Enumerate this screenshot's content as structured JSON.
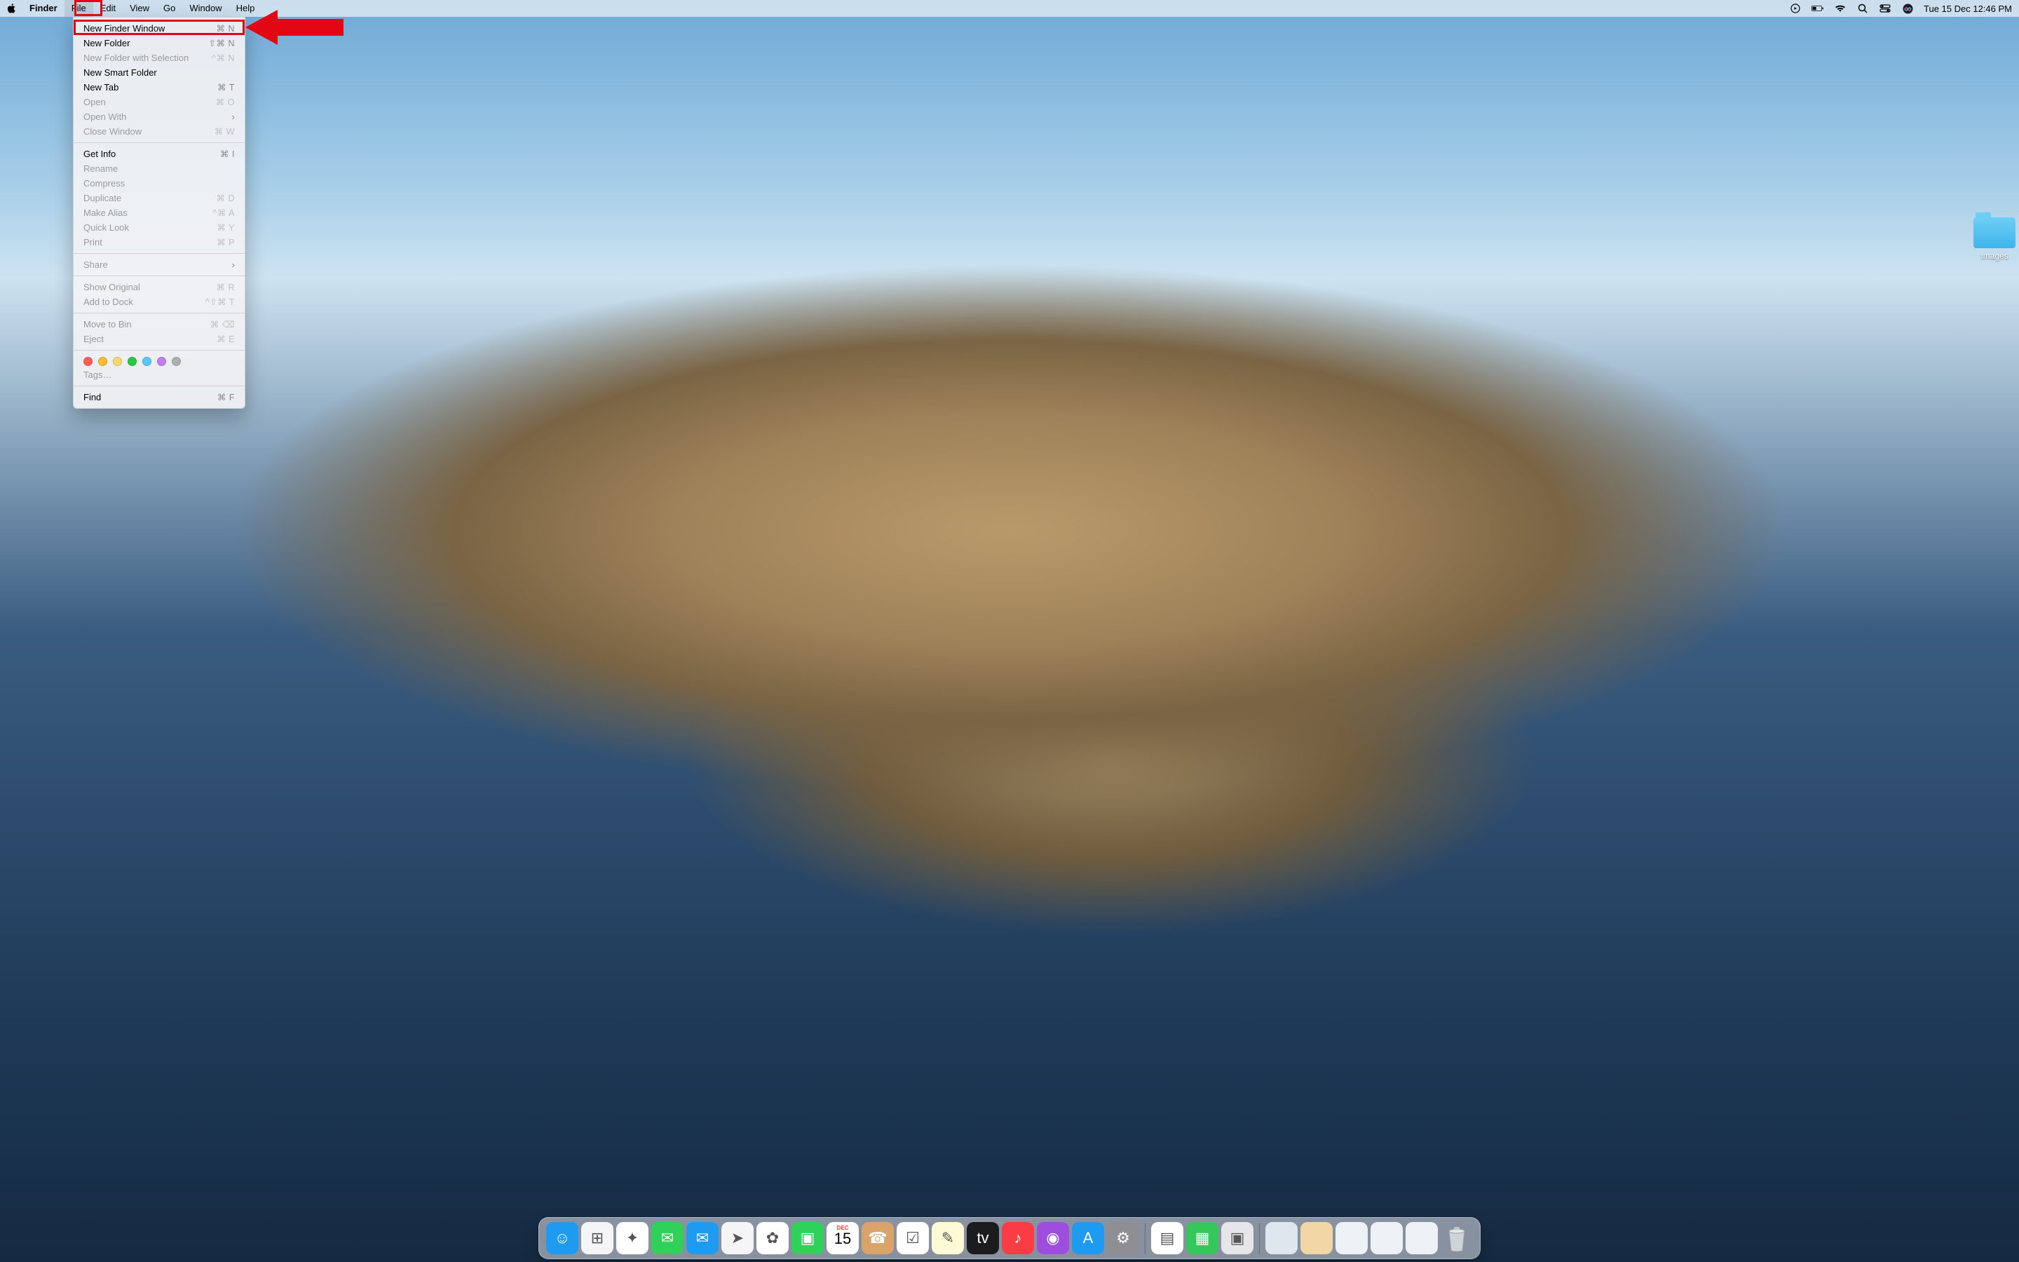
{
  "menubar": {
    "app_name": "Finder",
    "items": [
      "File",
      "Edit",
      "View",
      "Go",
      "Window",
      "Help"
    ],
    "clock": "Tue 15 Dec  12:46 PM"
  },
  "file_menu": {
    "groups": [
      [
        {
          "label": "New Finder Window",
          "shortcut": "⌘ N",
          "disabled": false,
          "highlight": true
        },
        {
          "label": "New Folder",
          "shortcut": "⇧⌘ N",
          "disabled": false
        },
        {
          "label": "New Folder with Selection",
          "shortcut": "^⌘ N",
          "disabled": true
        },
        {
          "label": "New Smart Folder",
          "shortcut": "",
          "disabled": false
        },
        {
          "label": "New Tab",
          "shortcut": "⌘ T",
          "disabled": false
        },
        {
          "label": "Open",
          "shortcut": "⌘ O",
          "disabled": true
        },
        {
          "label": "Open With",
          "shortcut": "",
          "disabled": true,
          "submenu": true
        },
        {
          "label": "Close Window",
          "shortcut": "⌘ W",
          "disabled": true
        }
      ],
      [
        {
          "label": "Get Info",
          "shortcut": "⌘ I",
          "disabled": false
        },
        {
          "label": "Rename",
          "shortcut": "",
          "disabled": true
        },
        {
          "label": "Compress",
          "shortcut": "",
          "disabled": true
        },
        {
          "label": "Duplicate",
          "shortcut": "⌘ D",
          "disabled": true
        },
        {
          "label": "Make Alias",
          "shortcut": "^⌘ A",
          "disabled": true
        },
        {
          "label": "Quick Look",
          "shortcut": "⌘ Y",
          "disabled": true
        },
        {
          "label": "Print",
          "shortcut": "⌘ P",
          "disabled": true
        }
      ],
      [
        {
          "label": "Share",
          "shortcut": "",
          "disabled": true,
          "submenu": true
        }
      ],
      [
        {
          "label": "Show Original",
          "shortcut": "⌘ R",
          "disabled": true
        },
        {
          "label": "Add to Dock",
          "shortcut": "^⇧⌘ T",
          "disabled": true
        }
      ],
      [
        {
          "label": "Move to Bin",
          "shortcut": "⌘ ⌫",
          "disabled": true
        },
        {
          "label": "Eject",
          "shortcut": "⌘ E",
          "disabled": true
        }
      ],
      [
        {
          "tags": true
        },
        {
          "label": "Tags…",
          "shortcut": "",
          "disabled": true
        }
      ],
      [
        {
          "label": "Find",
          "shortcut": "⌘ F",
          "disabled": false
        }
      ]
    ],
    "tag_colors": [
      "#ff5f57",
      "#febc2e",
      "#f7d774",
      "#28c840",
      "#5ac8fa",
      "#c07ff0",
      "#b0b0b0"
    ]
  },
  "desktop": {
    "folder_label": "Images"
  },
  "dock": {
    "apps": [
      {
        "name": "finder",
        "bg": "#1e9bf0"
      },
      {
        "name": "launchpad",
        "bg": "#f5f5f7"
      },
      {
        "name": "safari",
        "bg": "#ffffff"
      },
      {
        "name": "messages",
        "bg": "#30d158"
      },
      {
        "name": "mail",
        "bg": "#1e9bf0"
      },
      {
        "name": "maps",
        "bg": "#f5f5f7"
      },
      {
        "name": "photos",
        "bg": "#ffffff"
      },
      {
        "name": "facetime",
        "bg": "#30d158"
      },
      {
        "name": "calendar",
        "bg": "#ffffff"
      },
      {
        "name": "contacts",
        "bg": "#d9a36a"
      },
      {
        "name": "reminders",
        "bg": "#ffffff"
      },
      {
        "name": "notes",
        "bg": "#fff9d6"
      },
      {
        "name": "tv",
        "bg": "#1c1c1e"
      },
      {
        "name": "music",
        "bg": "#fc3c44"
      },
      {
        "name": "podcasts",
        "bg": "#9d4edd"
      },
      {
        "name": "appstore",
        "bg": "#1e9bf0"
      },
      {
        "name": "settings",
        "bg": "#8e8e93"
      }
    ],
    "extras": [
      {
        "name": "preview",
        "bg": "#ffffff"
      },
      {
        "name": "box-green",
        "bg": "#34c759"
      },
      {
        "name": "virtualbox",
        "bg": "#e5e5ea"
      }
    ],
    "minimized": [
      {
        "name": "window-1",
        "bg": "#dfe6ee"
      },
      {
        "name": "window-2",
        "bg": "#f2d7a6"
      },
      {
        "name": "window-3",
        "bg": "#eef2f6"
      },
      {
        "name": "window-4",
        "bg": "#eef2f6"
      },
      {
        "name": "window-5",
        "bg": "#eef2f6"
      }
    ],
    "calendar_badge": "15",
    "calendar_month": "DEC"
  }
}
